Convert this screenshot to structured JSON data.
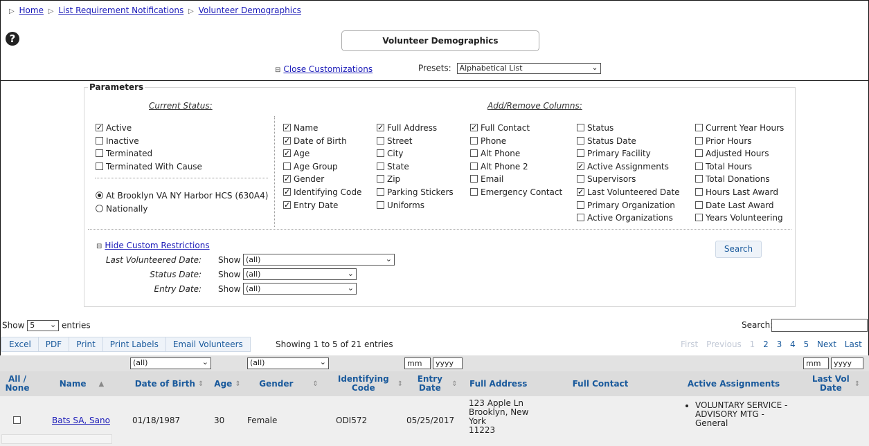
{
  "breadcrumb": {
    "items": [
      "Home",
      "List Requirement Notifications",
      "Volunteer Demographics"
    ]
  },
  "header": {
    "title": "Volunteer Demographics",
    "help_icon": "?"
  },
  "customize": {
    "link": "Close Customizations",
    "presets_label": "Presets:",
    "presets_value": "Alphabetical List"
  },
  "params": {
    "legend": "Parameters",
    "status_title": "Current Status:",
    "columns_title": "Add/Remove Columns:",
    "status": [
      {
        "label": "Active",
        "checked": true
      },
      {
        "label": "Inactive",
        "checked": false
      },
      {
        "label": "Terminated",
        "checked": false
      },
      {
        "label": "Terminated With Cause",
        "checked": false
      }
    ],
    "scope": [
      {
        "label": "At Brooklyn VA NY Harbor HCS (630A4)",
        "selected": true
      },
      {
        "label": "Nationally",
        "selected": false
      }
    ],
    "col1": [
      {
        "label": "Name",
        "checked": true
      },
      {
        "label": "Date of Birth",
        "checked": true
      },
      {
        "label": "Age",
        "checked": true
      },
      {
        "label": "Age Group",
        "checked": false
      },
      {
        "label": "Gender",
        "checked": true
      },
      {
        "label": "Identifying Code",
        "checked": true
      },
      {
        "label": "Entry Date",
        "checked": true
      }
    ],
    "col2": [
      {
        "label": "Full Address",
        "checked": true
      },
      {
        "label": "Street",
        "checked": false
      },
      {
        "label": "City",
        "checked": false
      },
      {
        "label": "State",
        "checked": false
      },
      {
        "label": "Zip",
        "checked": false
      },
      {
        "label": "Parking Stickers",
        "checked": false
      },
      {
        "label": "Uniforms",
        "checked": false
      }
    ],
    "col3": [
      {
        "label": "Full Contact",
        "checked": true
      },
      {
        "label": "Phone",
        "checked": false
      },
      {
        "label": "Alt Phone",
        "checked": false
      },
      {
        "label": "Alt Phone 2",
        "checked": false
      },
      {
        "label": "Email",
        "checked": false
      },
      {
        "label": "Emergency Contact",
        "checked": false
      }
    ],
    "col4": [
      {
        "label": "Status",
        "checked": false
      },
      {
        "label": "Status Date",
        "checked": false
      },
      {
        "label": "Primary Facility",
        "checked": false
      },
      {
        "label": "Active Assignments",
        "checked": true
      },
      {
        "label": "Supervisors",
        "checked": false
      },
      {
        "label": "Last Volunteered Date",
        "checked": true
      },
      {
        "label": "Primary Organization",
        "checked": false
      },
      {
        "label": "Active Organizations",
        "checked": false
      }
    ],
    "col5": [
      {
        "label": "Current Year Hours",
        "checked": false
      },
      {
        "label": "Prior Hours",
        "checked": false
      },
      {
        "label": "Adjusted Hours",
        "checked": false
      },
      {
        "label": "Total Hours",
        "checked": false
      },
      {
        "label": "Total Donations",
        "checked": false
      },
      {
        "label": "Hours Last Award",
        "checked": false
      },
      {
        "label": "Date Last Award",
        "checked": false
      },
      {
        "label": "Years Volunteering",
        "checked": false
      }
    ],
    "search_button": "Search"
  },
  "restrictions": {
    "link": "Hide Custom Restrictions",
    "show_label": "Show",
    "items": [
      {
        "label": "Last Volunteered Date:",
        "value": "(all)"
      },
      {
        "label": "Status Date:",
        "value": "(all)"
      },
      {
        "label": "Entry Date:",
        "value": "(all)"
      }
    ]
  },
  "table_controls": {
    "show_label": "Show",
    "entries_value": "5",
    "entries_label": "entries",
    "search_label": "Search:",
    "buttons": [
      "Excel",
      "PDF",
      "Print",
      "Print Labels",
      "Email Volunteers"
    ],
    "showing": "Showing 1 to 5 of 21 entries",
    "pager": {
      "first": "First",
      "previous": "Previous",
      "pages": [
        "1",
        "2",
        "3",
        "4",
        "5"
      ],
      "next": "Next",
      "last": "Last"
    }
  },
  "filters": {
    "dob": "(all)",
    "gender": "(all)",
    "mm": "mm",
    "yyyy": "yyyy"
  },
  "table": {
    "headers": {
      "all": "All / None",
      "name": "Name",
      "dob": "Date of Birth",
      "age": "Age",
      "gender": "Gender",
      "idcode": "Identifying Code",
      "entry": "Entry Date",
      "address": "Full Address",
      "contact": "Full Contact",
      "assign": "Active Assignments",
      "lastvol": "Last Vol Date"
    },
    "rows": [
      {
        "name": "Bats SA, Sano",
        "dob": "01/18/1987",
        "age": "30",
        "gender": "Female",
        "idcode": "ODI572",
        "entry": "05/25/2017",
        "address": [
          "123 Apple Ln",
          "Brooklyn, New",
          "York",
          "11223"
        ],
        "assignment": "VOLUNTARY SERVICE - ADVISORY MTG - General"
      }
    ]
  }
}
